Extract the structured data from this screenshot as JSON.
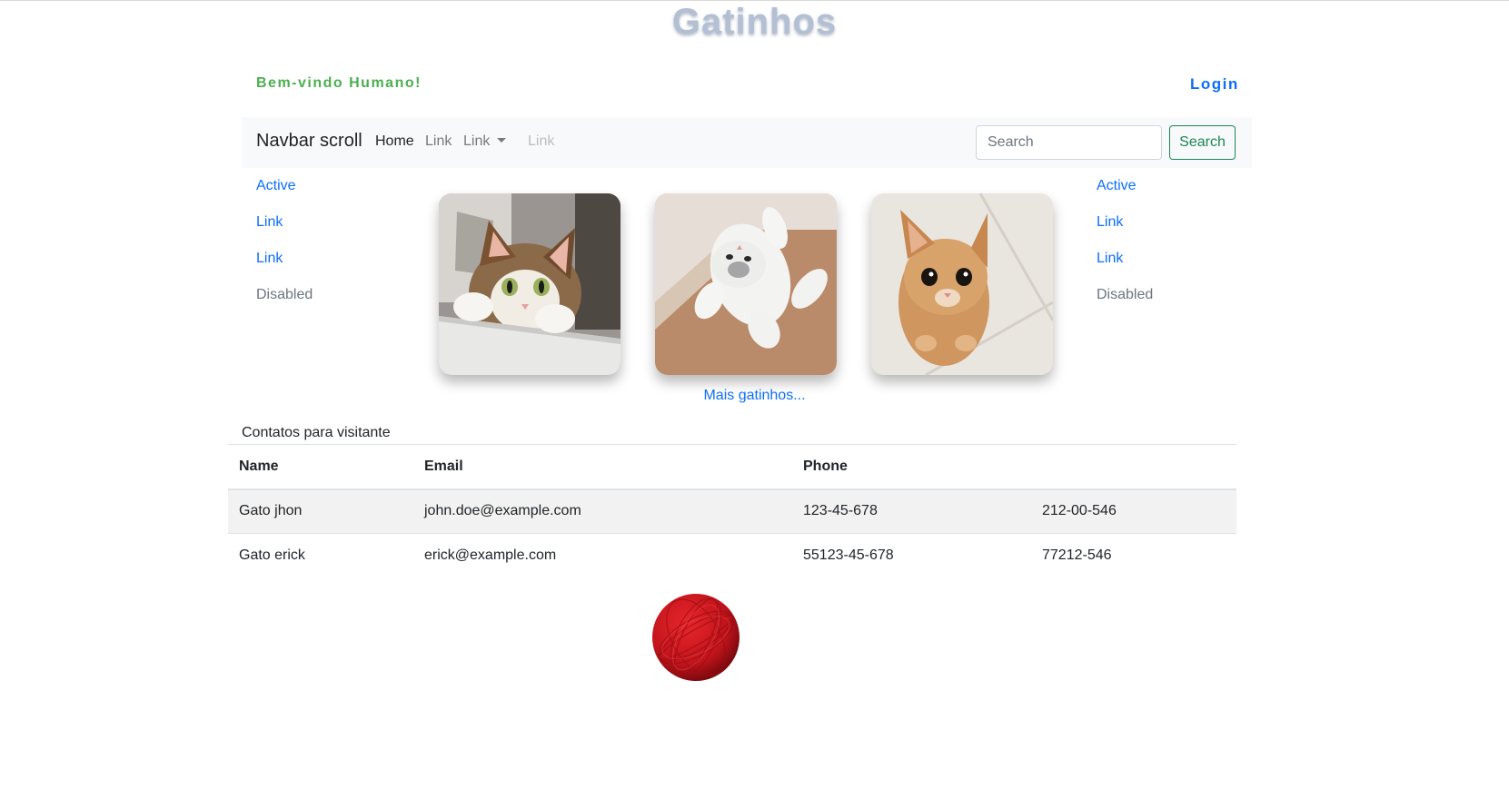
{
  "header": {
    "title": "Gatinhos",
    "greeting": "Bem-vindo Humano!",
    "login_label": "Login"
  },
  "navbar": {
    "brand": "Navbar scroll",
    "links": [
      "Home",
      "Link",
      "Link",
      "Link"
    ],
    "search_placeholder": "Search",
    "search_button": "Search"
  },
  "left_nav": [
    "Active",
    "Link",
    "Link",
    "Disabled"
  ],
  "right_nav": [
    "Active",
    "Link",
    "Link",
    "Disabled"
  ],
  "gallery": {
    "more_link": "Mais gatinhos..."
  },
  "contacts": {
    "caption": "Contatos para visitante",
    "headers": [
      "Name",
      "Email",
      "Phone",
      ""
    ],
    "rows": [
      [
        "Gato jhon",
        "john.doe@example.com",
        "123-45-678",
        "212-00-546"
      ],
      [
        "Gato erick",
        "erick@example.com",
        "55123-45-678",
        "77212-546"
      ]
    ]
  },
  "colors": {
    "accent": "#0d6efd",
    "greeting": "#4caf50",
    "search_button": "#198754",
    "navbar_bg": "#f8f9fa"
  }
}
